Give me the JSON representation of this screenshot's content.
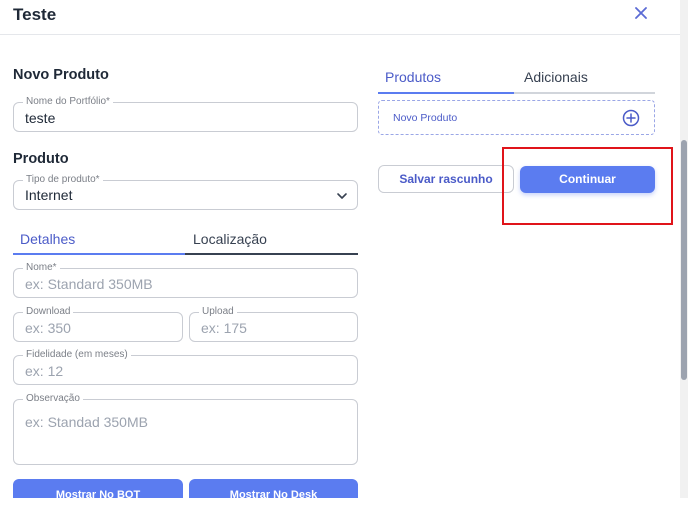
{
  "modal": {
    "title": "Teste"
  },
  "left": {
    "novo_produto_heading": "Novo Produto",
    "portfolio": {
      "label": "Nome do Portfólio*",
      "value": "teste"
    },
    "produto_heading": "Produto",
    "tipo": {
      "label": "Tipo de produto*",
      "value": "Internet"
    },
    "tabs": [
      {
        "label": "Detalhes",
        "active": true
      },
      {
        "label": "Localização",
        "active": false
      }
    ],
    "nome": {
      "label": "Nome*",
      "placeholder": "ex: Standard 350MB"
    },
    "download": {
      "label": "Download",
      "placeholder": "ex: 350"
    },
    "upload": {
      "label": "Upload",
      "placeholder": "ex: 175"
    },
    "fidelidade": {
      "label": "Fidelidade (em meses)",
      "placeholder": "ex: 12"
    },
    "observacao": {
      "label": "Observação",
      "placeholder": "ex: Standad 350MB"
    },
    "btn_bot": "Mostrar No BOT",
    "btn_desk": "Mostrar No Desk"
  },
  "right": {
    "tabs": [
      {
        "label": "Produtos",
        "active": true
      },
      {
        "label": "Adicionais",
        "active": false
      }
    ],
    "novo_produto_item": "Novo Produto",
    "salvar_label": "Salvar rascunho",
    "continuar_label": "Continuar"
  },
  "colors": {
    "accent": "#5b7cf0",
    "highlight": "#e0141a"
  }
}
